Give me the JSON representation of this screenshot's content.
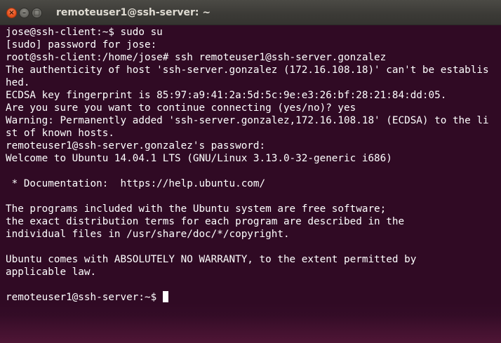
{
  "window": {
    "title": "remoteuser1@ssh-server: ~",
    "buttons": {
      "close_glyph": "×",
      "minimize_glyph": "–",
      "maximize_glyph": "□"
    }
  },
  "terminal": {
    "lines": [
      "jose@ssh-client:~$ sudo su",
      "[sudo] password for jose:",
      "root@ssh-client:/home/jose# ssh remoteuser1@ssh-server.gonzalez",
      "The authenticity of host 'ssh-server.gonzalez (172.16.108.18)' can't be establis",
      "hed.",
      "ECDSA key fingerprint is 85:97:a9:41:2a:5d:5c:9e:e3:26:bf:28:21:84:dd:05.",
      "Are you sure you want to continue connecting (yes/no)? yes",
      "Warning: Permanently added 'ssh-server.gonzalez,172.16.108.18' (ECDSA) to the li",
      "st of known hosts.",
      "remoteuser1@ssh-server.gonzalez's password:",
      "Welcome to Ubuntu 14.04.1 LTS (GNU/Linux 3.13.0-32-generic i686)",
      "",
      " * Documentation:  https://help.ubuntu.com/",
      "",
      "The programs included with the Ubuntu system are free software;",
      "the exact distribution terms for each program are described in the",
      "individual files in /usr/share/doc/*/copyright.",
      "",
      "Ubuntu comes with ABSOLUTELY NO WARRANTY, to the extent permitted by",
      "applicable law.",
      ""
    ],
    "prompt": "remoteuser1@ssh-server:~$ "
  },
  "colors": {
    "background": "#300a24",
    "foreground": "#ffffff",
    "titlebar": "#3c3b37",
    "close_button": "#e95420"
  }
}
